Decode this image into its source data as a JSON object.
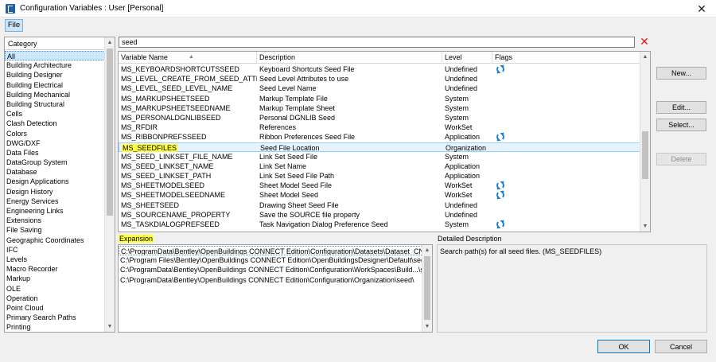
{
  "window": {
    "title": "Configuration Variables : User [Personal]",
    "close_label": "✕"
  },
  "menu": {
    "file": "File"
  },
  "categories": {
    "header": "Category",
    "items": [
      "All",
      "Building Architecture",
      "Building Designer",
      "Building Electrical",
      "Building Mechanical",
      "Building Structural",
      "Cells",
      "Clash Detection",
      "Colors",
      "DWG/DXF",
      "Data Files",
      "DataGroup System",
      "Database",
      "Design Applications",
      "Design History",
      "Energy Services",
      "Engineering Links",
      "Extensions",
      "File Saving",
      "Geographic Coordinates",
      "IFC",
      "Levels",
      "Macro Recorder",
      "Markup",
      "OLE",
      "Operation",
      "Point Cloud",
      "Primary Search Paths",
      "Printing"
    ]
  },
  "search": {
    "value": "seed",
    "clear_icon": "clear-x-icon"
  },
  "table": {
    "columns": [
      "Variable Name",
      "Description",
      "Level",
      "Flags"
    ],
    "rows": [
      {
        "name": "MS_KEYBOARDSHORTCUTSSEED",
        "desc": "Keyboard Shortcuts Seed File",
        "level": "Undefined",
        "flag": true
      },
      {
        "name": "MS_LEVEL_CREATE_FROM_SEED_ATTRIBU...",
        "desc": "Seed Level Attributes to use",
        "level": "Undefined",
        "flag": false
      },
      {
        "name": "MS_LEVEL_SEED_LEVEL_NAME",
        "desc": "Seed Level Name",
        "level": "Undefined",
        "flag": false
      },
      {
        "name": "MS_MARKUPSHEETSEED",
        "desc": "Markup Template File",
        "level": "System",
        "flag": false
      },
      {
        "name": "MS_MARKUPSHEETSEEDNAME",
        "desc": "Markup Template Sheet",
        "level": "System",
        "flag": false
      },
      {
        "name": "MS_PERSONALDGNLIBSEED",
        "desc": "Personal DGNLIB Seed",
        "level": "System",
        "flag": false
      },
      {
        "name": "MS_RFDIR",
        "desc": "References",
        "level": "WorkSet",
        "flag": false
      },
      {
        "name": "MS_RIBBONPREFSSEED",
        "desc": "Ribbon Preferences Seed File",
        "level": "Application",
        "flag": true
      },
      {
        "name": "MS_SEEDFILES",
        "desc": "Seed File Location",
        "level": "Organization",
        "flag": false
      },
      {
        "name": "MS_SEED_LINKSET_FILE_NAME",
        "desc": "Link Set Seed File",
        "level": "System",
        "flag": false
      },
      {
        "name": "MS_SEED_LINKSET_NAME",
        "desc": "Link Set Name",
        "level": "Application",
        "flag": false
      },
      {
        "name": "MS_SEED_LINKSET_PATH",
        "desc": "Link Set Seed File Path",
        "level": "Application",
        "flag": false
      },
      {
        "name": "MS_SHEETMODELSEED",
        "desc": "Sheet Model Seed File",
        "level": "WorkSet",
        "flag": true
      },
      {
        "name": "MS_SHEETMODELSEEDNAME",
        "desc": "Sheet Model Seed",
        "level": "WorkSet",
        "flag": true
      },
      {
        "name": "MS_SHEETSEED",
        "desc": "Drawing Sheet Seed File",
        "level": "Undefined",
        "flag": false
      },
      {
        "name": "MS_SOURCENAME_PROPERTY",
        "desc": "Save the SOURCE file property",
        "level": "Undefined",
        "flag": false
      },
      {
        "name": "MS_TASKDIALOGPREFSEED",
        "desc": "Task Navigation Dialog Preference Seed",
        "level": "System",
        "flag": true
      }
    ],
    "selected_index": 8,
    "flag_icon": "refresh-icon"
  },
  "buttons": {
    "new": "New...",
    "edit": "Edit...",
    "select": "Select...",
    "delete": "Delete",
    "ok": "OK",
    "cancel": "Cancel"
  },
  "expansion": {
    "label": "Expansion",
    "items": [
      "C:\\ProgramData\\Bentley\\OpenBuildings CONNECT Edition\\Configuration\\Datasets\\Dataset_CN\\Seed\\",
      "C:\\Program Files\\Bentley\\OpenBuildings CONNECT Edition\\OpenBuildingsDesigner\\Default\\seed\\",
      "C:\\ProgramData\\Bentley\\OpenBuildings CONNECT Edition\\Configuration\\WorkSpaces\\Build...\\seed\\",
      "C:\\ProgramData\\Bentley\\OpenBuildings CONNECT Edition\\Configuration\\Organization\\seed\\"
    ]
  },
  "description": {
    "label": "Detailed Description",
    "text": "Search path(s) for all seed files.  (MS_SEEDFILES)"
  }
}
